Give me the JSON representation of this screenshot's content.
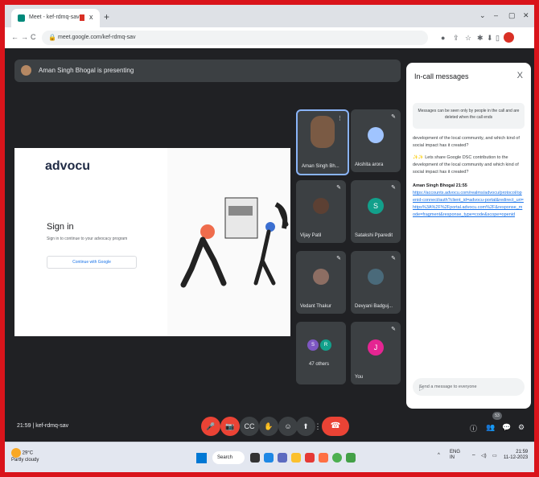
{
  "browser": {
    "tab_title": "Meet - kef-rdmq-sav",
    "tab_close": "x",
    "new_tab": "+",
    "window_controls": [
      "⌄",
      "–",
      "▢",
      "✕"
    ],
    "nav": [
      "←",
      "→",
      "C"
    ],
    "url": "meet.google.com/kef-rdmq-sav",
    "toolbar_icons": [
      "●",
      "⇪",
      "☆",
      "✱",
      "⬇",
      "▯"
    ]
  },
  "meet": {
    "presenting_banner": "Aman Singh Bhogal is presenting",
    "shared_screen": {
      "logo": "advocu",
      "heading": "Sign in",
      "subtext": "Sign in to continue to your advocacy program",
      "google_button": "Continue with Google"
    },
    "participants": [
      {
        "name": "Aman Singh Bh...",
        "initial": "",
        "color": "#7a5a44",
        "speaking": true
      },
      {
        "name": "Akshita arora",
        "initial": "",
        "color": "#a0c4ff",
        "speaking": false
      },
      {
        "name": "Vijay Patil",
        "initial": "",
        "color": "#5c4033",
        "speaking": false
      },
      {
        "name": "Satakshi Pparedit",
        "initial": "S",
        "color": "#12a08b",
        "speaking": false
      },
      {
        "name": "Vedant Thakur",
        "initial": "",
        "color": "#8d6e63",
        "speaking": false
      },
      {
        "name": "Devyani Badguj...",
        "initial": "",
        "color": "#4a6a7a",
        "speaking": false
      },
      {
        "name": "47 others",
        "initial": "",
        "color": "#1a73e8",
        "speaking": false
      },
      {
        "name": "You",
        "initial": "J",
        "color": "#e52592",
        "speaking": false
      }
    ],
    "others_initials": [
      "S",
      "R"
    ],
    "chat": {
      "title": "In-call messages",
      "close": "X",
      "notice": "Messages can be seen only by people in the call and are deleted when the call ends",
      "messages": [
        "development of the local community, and which kind of social impact has it created?",
        "✨✨ Lets share Google DSC contribution to the development of the local community and which kind of social impact has it created?"
      ],
      "sender": "Aman Singh Bhogal  21:55",
      "link": "https://accounts.advocu.com/realms/advocu/protocol/openid-connect/auth?client_id=advocu-portal&redirect_uri=https%3A%2F%2Fportal.advocu.com%2F&response_mode=fragment&response_type=code&scope=openid",
      "input_placeholder": "Send a message to everyone",
      "send": "▷"
    },
    "bottom": {
      "time": "21:59",
      "separator": "|",
      "meeting_code": "kef-rdmq-sav",
      "controls": [
        "🎤",
        "📷",
        "CC",
        "✋",
        "☺",
        "⬆",
        "⋮"
      ],
      "end_call": "☎",
      "right_icons": [
        "ⓘ",
        "👥",
        "💬",
        "⚙"
      ],
      "people_count": "53"
    }
  },
  "taskbar": {
    "weather_temp": "29°C",
    "weather_desc": "Partly cloudy",
    "search": "Search",
    "tray_up": "^",
    "lang_top": "ENG",
    "lang_bottom": "IN",
    "time": "21:59",
    "date": "11-12-2023"
  }
}
